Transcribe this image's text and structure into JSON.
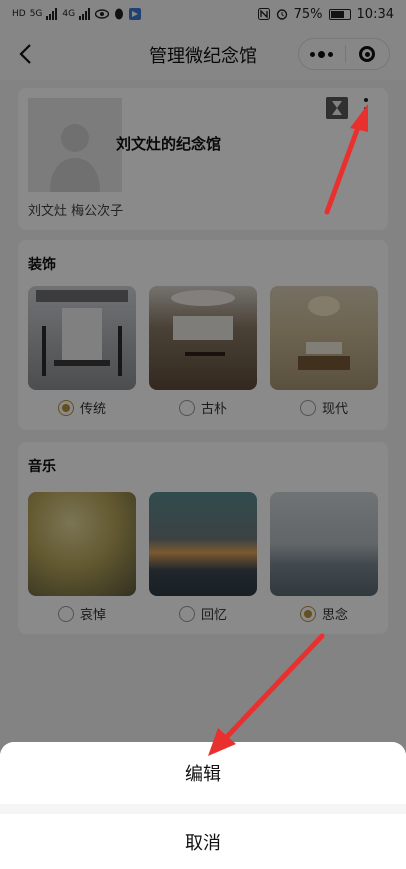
{
  "status_bar": {
    "left_indicators": [
      "HD",
      "5G",
      "4G"
    ],
    "battery": "75%",
    "battery_level": 0.75,
    "time": "10:34"
  },
  "nav": {
    "title": "管理微纪念馆"
  },
  "profile": {
    "memorial_name": "刘文灶的纪念馆",
    "people": "刘文灶 梅公次子"
  },
  "decoration": {
    "title": "装饰",
    "options": [
      {
        "label": "传统",
        "selected": true
      },
      {
        "label": "古朴",
        "selected": false
      },
      {
        "label": "现代",
        "selected": false
      }
    ]
  },
  "music": {
    "title": "音乐",
    "options": [
      {
        "label": "哀悼",
        "selected": false
      },
      {
        "label": "回忆",
        "selected": false
      },
      {
        "label": "思念",
        "selected": true
      }
    ]
  },
  "action_sheet": {
    "edit": "编辑",
    "cancel": "取消"
  },
  "colors": {
    "accent": "#b8933b",
    "annotation_arrow": "#e8312f"
  }
}
